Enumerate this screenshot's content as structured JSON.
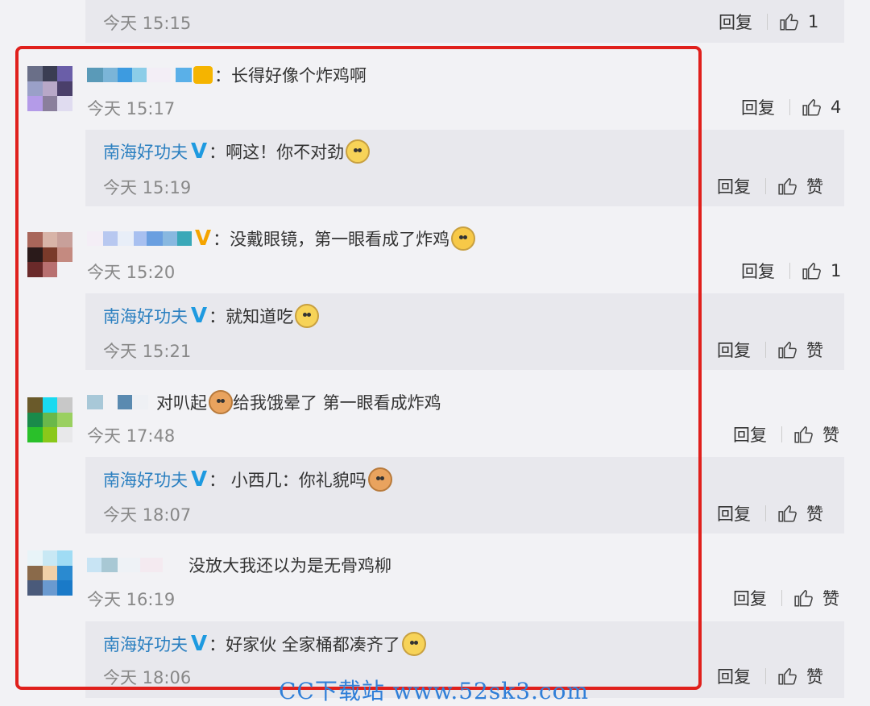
{
  "top_reply": {
    "time": "今天 15:15",
    "reply_label": "回复",
    "likes": "1"
  },
  "comments": [
    {
      "content": "：长得好像个炸鸡啊",
      "time": "今天 15:17",
      "reply_label": "回复",
      "likes": "4",
      "reply": {
        "author": "南海好功夫",
        "content": "：啊这！你不对劲",
        "time": "今天 15:19",
        "reply_label": "回复",
        "likes": "赞"
      }
    },
    {
      "content": "：没戴眼镜，第一眼看成了炸鸡",
      "time": "今天 15:20",
      "reply_label": "回复",
      "likes": "1",
      "reply": {
        "author": "南海好功夫",
        "content": "：就知道吃",
        "time": "今天 15:21",
        "reply_label": "回复",
        "likes": "赞"
      }
    },
    {
      "content_a": "对叭起",
      "content_b": " 给我饿晕了 第一眼看成炸鸡",
      "time": "今天 17:48",
      "reply_label": "回复",
      "likes": "赞",
      "reply": {
        "author": "南海好功夫",
        "content": "： 小西几：你礼貌吗",
        "time": "今天 18:07",
        "reply_label": "回复",
        "likes": "赞"
      }
    },
    {
      "content": "没放大我还以为是无骨鸡柳",
      "time": "今天 16:19",
      "reply_label": "回复",
      "likes": "赞",
      "reply": {
        "author": "南海好功夫",
        "content": "：好家伙 全家桶都凑齐了",
        "time": "今天 18:06",
        "reply_label": "回复",
        "likes": "赞"
      }
    }
  ],
  "verified_badge": "V",
  "watermark": "CC下载站 www.52sk3.com",
  "colors": {
    "highlight_frame": "#e0201c",
    "link_name": "#2a7fc0",
    "verified_blue": "#1e9ae0",
    "verified_gold": "#f5a400"
  }
}
